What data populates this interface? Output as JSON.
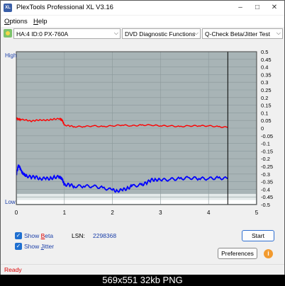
{
  "window": {
    "title": "PlexTools Professional XL V3.16",
    "app_icon_text": "XL"
  },
  "menu": [
    {
      "label": "Options",
      "accel": "O"
    },
    {
      "label": "Help",
      "accel": "H"
    }
  ],
  "toolbar": {
    "drive": "HA:4 ID:0  PX-760A",
    "function": "DVD Diagnostic Functions",
    "test": "Q-Check Beta/Jitter Test"
  },
  "chart_data": {
    "type": "line",
    "xlim": [
      0,
      5
    ],
    "x_ticks": [
      "0",
      "1",
      "2",
      "3",
      "4",
      "5"
    ],
    "left_axis_labels": {
      "top": "High",
      "bottom": "Low"
    },
    "ylim": [
      -0.5,
      0.5
    ],
    "y_ticks": [
      "0.5",
      "0.45",
      "0.4",
      "0.35",
      "0.3",
      "0.25",
      "0.2",
      "0.15",
      "0.1",
      "0.05",
      "0",
      "-0.05",
      "-0.1",
      "-0.15",
      "-0.2",
      "-0.25",
      "-0.3",
      "-0.35",
      "-0.4",
      "-0.45",
      "-0.5"
    ],
    "end_marker_x": 4.4,
    "grid": true,
    "series": [
      {
        "color": "#ff0000",
        "axis": "right",
        "x": [
          0.0,
          0.05,
          0.1,
          0.2,
          0.3,
          0.4,
          0.5,
          0.6,
          0.7,
          0.8,
          0.9,
          0.95,
          1.0,
          1.1,
          1.2,
          1.4,
          1.6,
          1.8,
          2.0,
          2.2,
          2.4,
          2.6,
          2.8,
          3.0,
          3.2,
          3.4,
          3.6,
          3.8,
          4.0,
          4.2,
          4.4
        ],
        "y": [
          0.065,
          0.06,
          0.055,
          0.055,
          0.045,
          0.05,
          0.055,
          0.05,
          0.055,
          0.06,
          0.06,
          0.055,
          0.02,
          0.015,
          0.01,
          0.01,
          0.015,
          0.01,
          0.015,
          0.02,
          0.015,
          0.02,
          0.02,
          0.015,
          0.015,
          0.01,
          0.015,
          0.015,
          0.015,
          0.01,
          0.005
        ]
      },
      {
        "color": "#0000ff",
        "axis": "left",
        "x": [
          0.0,
          0.05,
          0.1,
          0.15,
          0.2,
          0.3,
          0.4,
          0.5,
          0.6,
          0.7,
          0.8,
          0.9,
          0.95,
          1.0,
          1.1,
          1.2,
          1.4,
          1.6,
          1.8,
          2.0,
          2.1,
          2.2,
          2.3,
          2.4,
          2.6,
          2.7,
          2.8,
          2.9,
          3.0,
          3.2,
          3.4,
          3.6,
          3.8,
          4.0,
          4.2,
          4.4
        ],
        "y": [
          -0.3,
          -0.24,
          -0.28,
          -0.3,
          -0.31,
          -0.32,
          -0.32,
          -0.33,
          -0.33,
          -0.33,
          -0.32,
          -0.32,
          -0.33,
          -0.37,
          -0.37,
          -0.38,
          -0.38,
          -0.38,
          -0.39,
          -0.405,
          -0.41,
          -0.405,
          -0.395,
          -0.38,
          -0.37,
          -0.36,
          -0.34,
          -0.335,
          -0.34,
          -0.335,
          -0.33,
          -0.325,
          -0.33,
          -0.33,
          -0.325,
          -0.33
        ]
      }
    ]
  },
  "controls": {
    "show_beta": "Show Beta",
    "show_beta_accel": "B",
    "show_jitter": "Show Jitter",
    "show_jitter_accel": "J",
    "lsn_label": "LSN:",
    "lsn_value": "2298368",
    "start": "Start",
    "preferences": "Preferences",
    "info_icon_text": "i"
  },
  "status": "Ready",
  "caption": "569x551  32kb  PNG"
}
